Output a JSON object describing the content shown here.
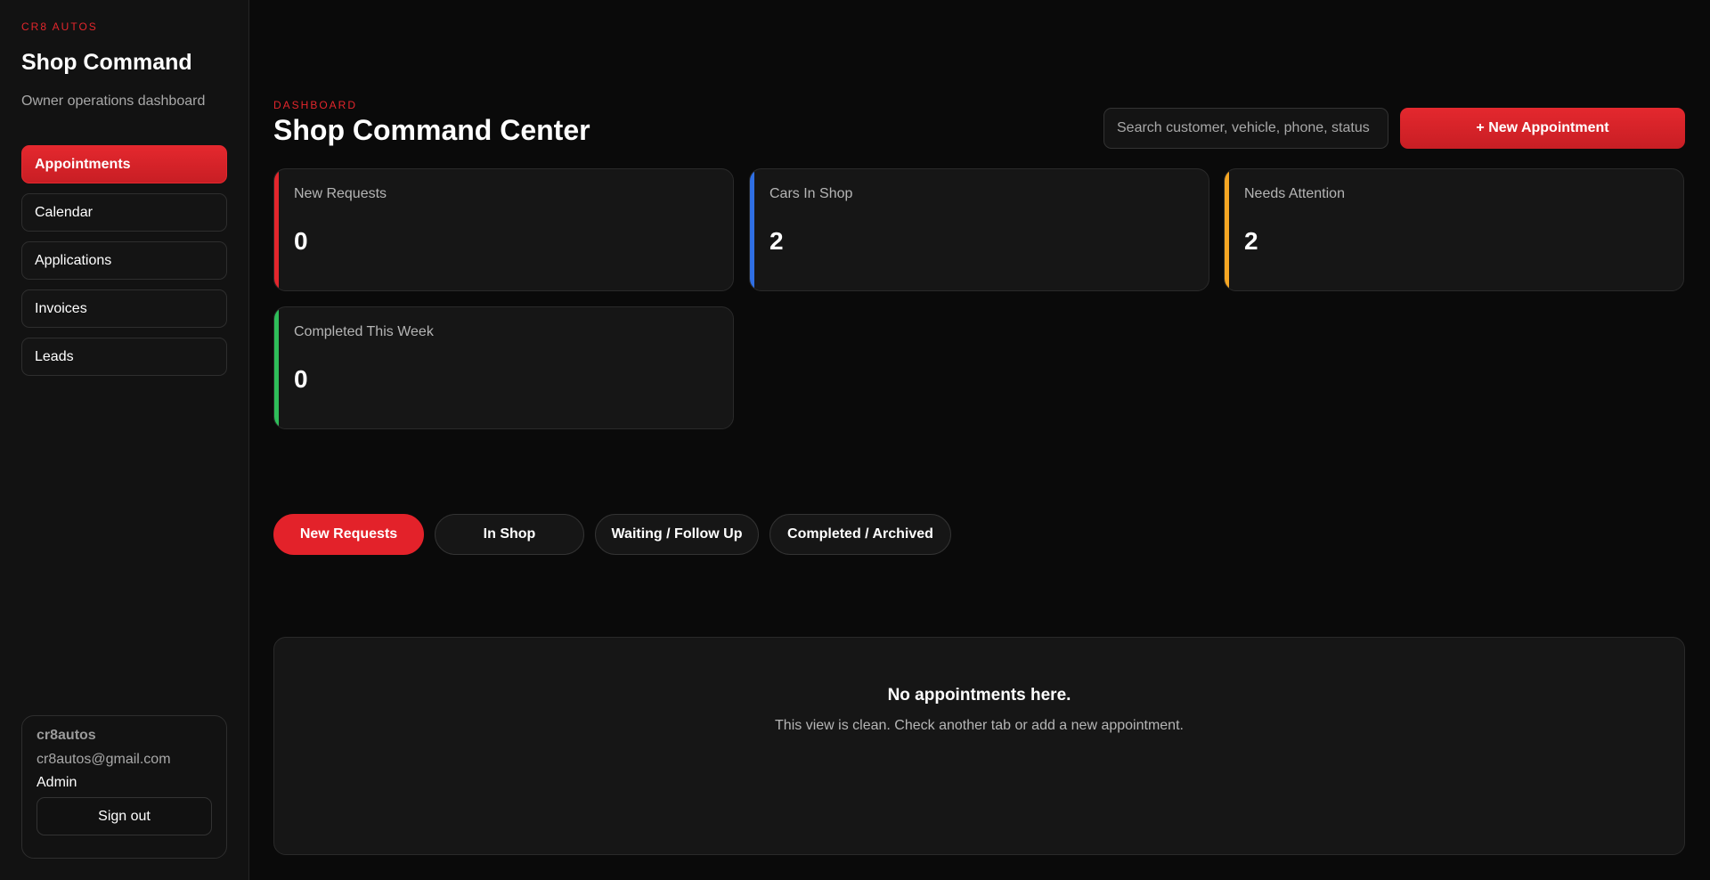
{
  "sidebar": {
    "brand_tag": "CR8 AUTOS",
    "title": "Shop Command",
    "subtitle": "Owner operations dashboard",
    "nav": [
      {
        "label": "Appointments",
        "active": true
      },
      {
        "label": "Calendar",
        "active": false
      },
      {
        "label": "Applications",
        "active": false
      },
      {
        "label": "Invoices",
        "active": false
      },
      {
        "label": "Leads",
        "active": false
      }
    ],
    "user": {
      "name": "cr8autos",
      "email": "cr8autos@gmail.com",
      "role": "Admin",
      "signout_label": "Sign out"
    }
  },
  "header": {
    "eyebrow": "DASHBOARD",
    "title": "Shop Command Center",
    "search_placeholder": "Search customer, vehicle, phone, status",
    "new_button_label": "+ New Appointment"
  },
  "stats": [
    {
      "label": "New Requests",
      "value": "0",
      "accent": "#e3262c"
    },
    {
      "label": "Cars In Shop",
      "value": "2",
      "accent": "#2f6fe4"
    },
    {
      "label": "Needs Attention",
      "value": "2",
      "accent": "#f5a623"
    },
    {
      "label": "Completed This Week",
      "value": "0",
      "accent": "#2ebd59"
    }
  ],
  "tabs": [
    {
      "label": "New Requests",
      "active": true
    },
    {
      "label": "In Shop",
      "active": false
    },
    {
      "label": "Waiting / Follow Up",
      "active": false
    },
    {
      "label": "Completed / Archived",
      "active": false
    }
  ],
  "empty_state": {
    "title": "No appointments here.",
    "message": "This view is clean. Check another tab or add a new appointment."
  },
  "colors": {
    "accent_red": "#e3262c",
    "background": "#0a0a0a",
    "panel": "#161616"
  }
}
